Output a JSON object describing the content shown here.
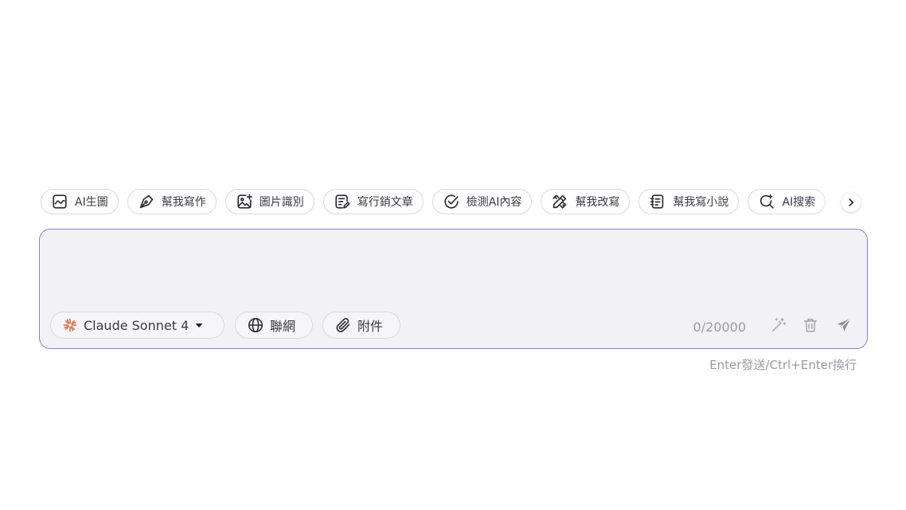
{
  "chips": [
    {
      "label": "AI生圖",
      "icon": "image-wave-icon"
    },
    {
      "label": "幫我寫作",
      "icon": "pen-nib-icon"
    },
    {
      "label": "圖片識別",
      "icon": "image-plus-icon"
    },
    {
      "label": "寫行銷文章",
      "icon": "document-edit-icon"
    },
    {
      "label": "檢測AI內容",
      "icon": "check-circle-icon"
    },
    {
      "label": "幫我改寫",
      "icon": "pencil-ruler-icon"
    },
    {
      "label": "幫我寫小說",
      "icon": "book-icon"
    },
    {
      "label": "AI搜索",
      "icon": "search-icon"
    }
  ],
  "chip_next_icon": "chevron-right-icon",
  "prompt": {
    "value": "",
    "placeholder": ""
  },
  "model": {
    "label": "Claude Sonnet 4",
    "logo": "claude-logo-icon",
    "logo_color": "#D97757",
    "dropdown_icon": "caret-down-icon"
  },
  "web_search": {
    "label": "聯網",
    "icon": "globe-icon"
  },
  "attachment": {
    "label": "附件",
    "icon": "paperclip-icon"
  },
  "counter": "0/20000",
  "tools": {
    "magic": "magic-wand-icon",
    "clear": "trash-icon",
    "send": "send-icon"
  },
  "hint": "Enter發送/Ctrl+Enter換行",
  "colors": {
    "border_accent": "#8A82C8",
    "input_bg": "#F2F2F6",
    "muted_text": "#9A9AA6",
    "text": "#3A3A44"
  }
}
